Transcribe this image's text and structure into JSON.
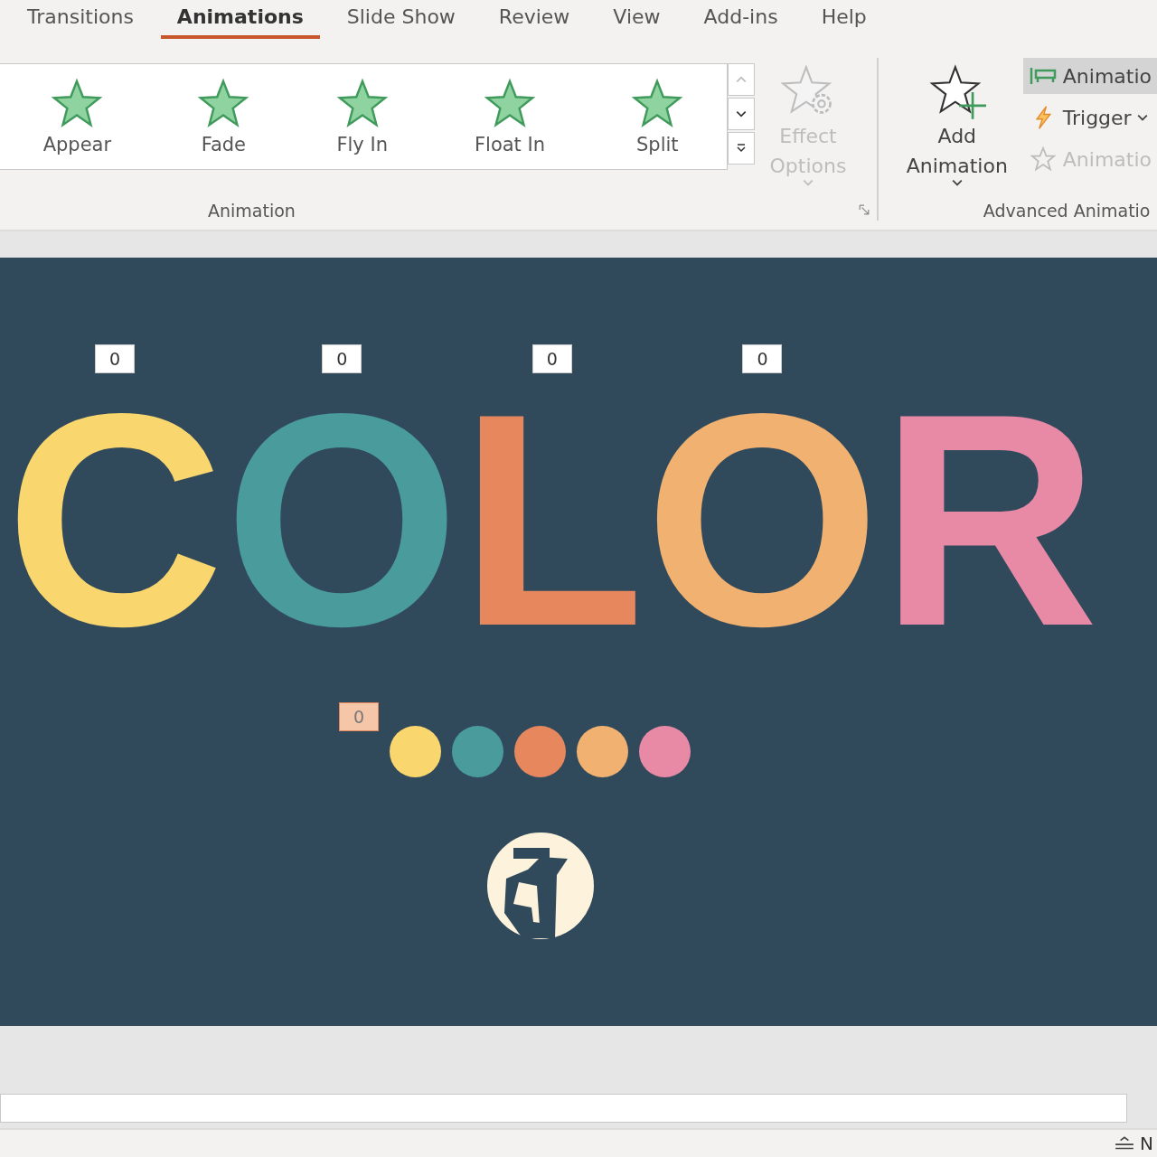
{
  "tabs": [
    {
      "label": "Transitions",
      "selected": false
    },
    {
      "label": "Animations",
      "selected": true
    },
    {
      "label": "Slide Show",
      "selected": false
    },
    {
      "label": "Review",
      "selected": false
    },
    {
      "label": "View",
      "selected": false
    },
    {
      "label": "Add-ins",
      "selected": false
    },
    {
      "label": "Help",
      "selected": false
    }
  ],
  "ribbon": {
    "animation_group": {
      "label": "Animation",
      "effects": [
        {
          "label": "Appear"
        },
        {
          "label": "Fade"
        },
        {
          "label": "Fly In"
        },
        {
          "label": "Float In"
        },
        {
          "label": "Split"
        }
      ],
      "effect_options": {
        "label": "Effect Options",
        "disabled": true
      }
    },
    "advanced_group": {
      "label": "Advanced Animatio",
      "add_animation": {
        "label": "Add Animation"
      },
      "items": [
        {
          "kind": "pane",
          "label": "Animatio",
          "selected": true,
          "disabled": false
        },
        {
          "kind": "trigger",
          "label": "Trigger",
          "selected": false,
          "disabled": false
        },
        {
          "kind": "painter",
          "label": "Animatio",
          "selected": false,
          "disabled": true
        }
      ]
    }
  },
  "slide": {
    "letters": [
      {
        "letter": "C",
        "color": "#f9d66e",
        "badge": "0"
      },
      {
        "letter": "O",
        "color": "#4a9b9b",
        "badge": "0"
      },
      {
        "letter": "L",
        "color": "#e7875e",
        "badge": "0"
      },
      {
        "letter": "O",
        "color": "#f1b171",
        "badge": "0"
      },
      {
        "letter": "R",
        "color": "#e889a6"
      }
    ],
    "dots_badge": "0",
    "dots": [
      {
        "color": "#f9d66e"
      },
      {
        "color": "#4a9b9b"
      },
      {
        "color": "#e7875e"
      },
      {
        "color": "#f1b171"
      },
      {
        "color": "#e889a6"
      }
    ]
  },
  "status_bar": {
    "text": "N"
  }
}
